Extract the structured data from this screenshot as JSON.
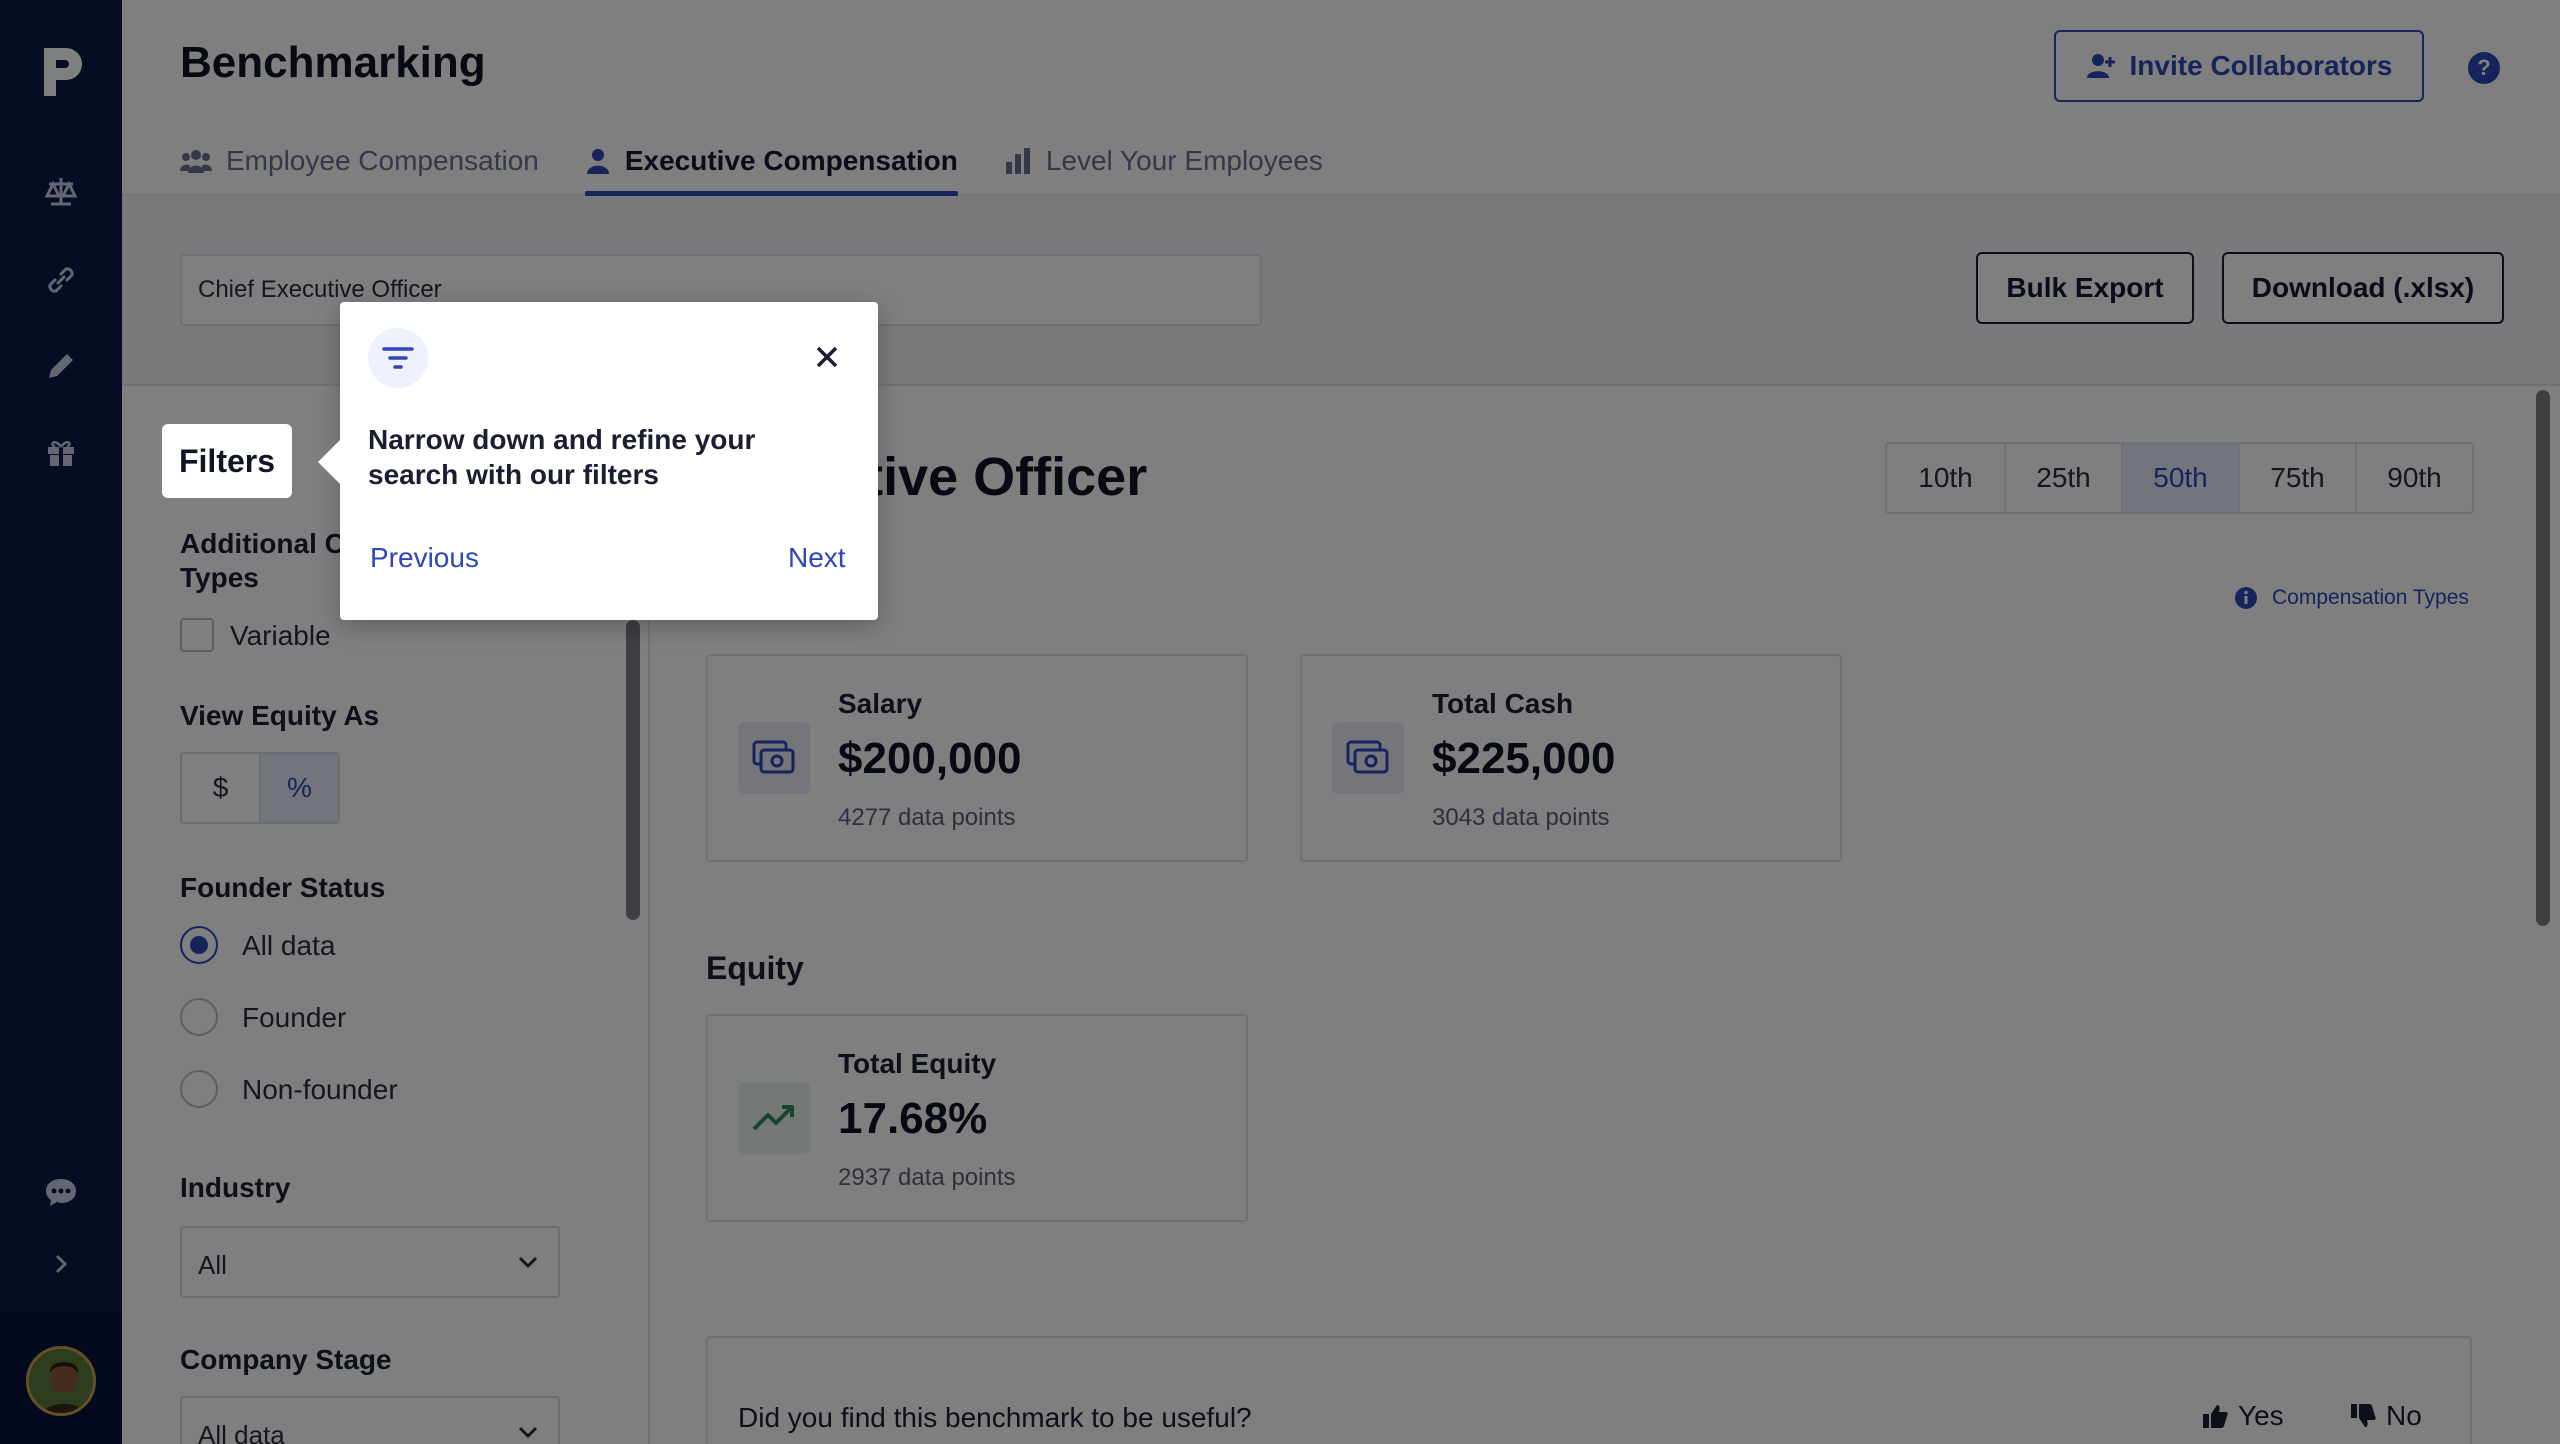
{
  "app": {
    "title": "Benchmarking",
    "invite_label": "Invite Collaborators",
    "help_label": "?"
  },
  "tabs": [
    {
      "label": "Employee Compensation",
      "icon": "people-icon",
      "active": false
    },
    {
      "label": "Executive Compensation",
      "icon": "person-icon",
      "active": true
    },
    {
      "label": "Level Your Employees",
      "icon": "bar-chart-icon",
      "active": false
    }
  ],
  "toolbar": {
    "search_value": "Chief Executive Officer",
    "bulk_export_label": "Bulk Export",
    "download_label": "Download (.xlsx)"
  },
  "filters": {
    "title": "Filters",
    "additional_label_line1": "Additional C",
    "additional_label_line2": "Types",
    "variable_label": "Variable",
    "equity_label": "View Equity As",
    "equity_options": [
      "$",
      "%"
    ],
    "equity_selected": "%",
    "founder_label": "Founder Status",
    "founder_options": [
      "All data",
      "Founder",
      "Non-founder"
    ],
    "founder_selected": "All data",
    "industry_label": "Industry",
    "industry_value": "All",
    "stage_label": "Company Stage",
    "stage_value": "All data"
  },
  "main": {
    "heading_visible": "Executive Officer",
    "percentiles": [
      "10th",
      "25th",
      "50th",
      "75th",
      "90th"
    ],
    "percentile_selected": "50th",
    "comp_types_label": "Compensation Types",
    "cards": [
      {
        "title": "Salary",
        "value": "$200,000",
        "sub": "4277 data points",
        "icon": "cash-icon"
      },
      {
        "title": "Total Cash",
        "value": "$225,000",
        "sub": "3043 data points",
        "icon": "cash-icon"
      }
    ],
    "equity_section": "Equity",
    "equity_card": {
      "title": "Total Equity",
      "value": "17.68%",
      "sub": "2937 data points",
      "icon": "trend-up-icon"
    },
    "feedback_question": "Did you find this benchmark to be useful?",
    "yes_label": "Yes",
    "no_label": "No"
  },
  "popover": {
    "text": "Narrow down and refine your search with our filters",
    "previous_label": "Previous",
    "next_label": "Next",
    "icon": "filter-icon"
  },
  "colors": {
    "rail": "#0d1947",
    "accent": "#2f46b7",
    "overlay": "rgba(0,0,0,0.5)"
  }
}
